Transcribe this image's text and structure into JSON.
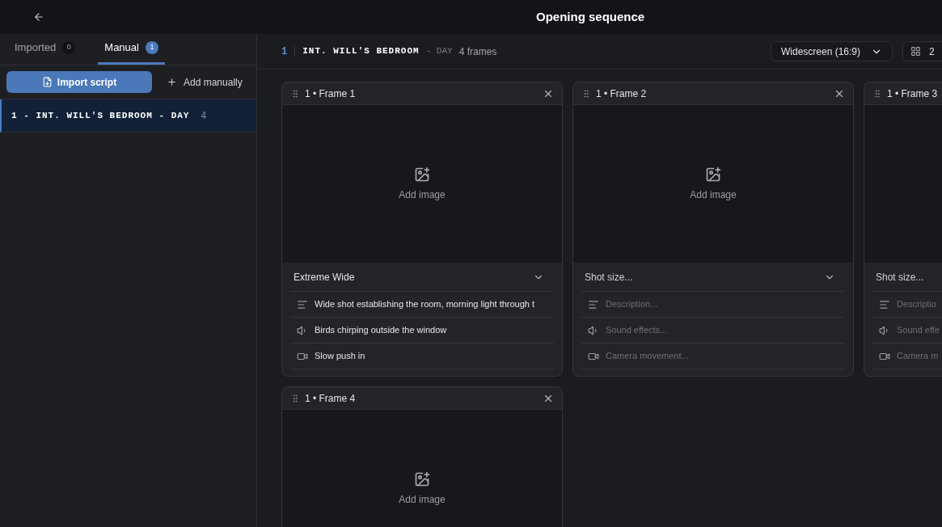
{
  "header": {
    "title": "Opening sequence"
  },
  "sidebar": {
    "tabs": [
      {
        "label": "Imported",
        "count": "0",
        "selected": false
      },
      {
        "label": "Manual",
        "count": "1",
        "selected": true
      }
    ],
    "actions": {
      "import": "Import script",
      "add": "Add manually"
    },
    "scenes": [
      {
        "label": "1 - INT. WILL'S BEDROOM - DAY",
        "count": "4",
        "selected": true
      }
    ]
  },
  "scene_header": {
    "number": "1",
    "heading": "INT. WILL'S BEDROOM",
    "time": "- DAY",
    "frames": "4 frames",
    "aspect": "Widescreen (16:9)",
    "columns": "2"
  },
  "frames": [
    {
      "title": "1 • Frame 1",
      "add_image": "Add image",
      "shot_size": {
        "value": "Extreme Wide"
      },
      "fields": [
        {
          "kind": "description",
          "value": "Wide shot establishing the room, morning light through t"
        },
        {
          "kind": "sound",
          "value": "Birds chirping outside the window"
        },
        {
          "kind": "camera",
          "value": "Slow push in"
        }
      ]
    },
    {
      "title": "1 • Frame 2",
      "add_image": "Add image",
      "shot_size": {
        "placeholder": "Shot size..."
      },
      "fields": [
        {
          "kind": "description",
          "placeholder": "Description..."
        },
        {
          "kind": "sound",
          "placeholder": "Sound effects..."
        },
        {
          "kind": "camera",
          "placeholder": "Camera movement..."
        }
      ]
    },
    {
      "title": "1 • Frame 3",
      "shot_size": {
        "placeholder": "Shot size..."
      },
      "fields": [
        {
          "kind": "description",
          "placeholder": "Descriptio"
        },
        {
          "kind": "sound",
          "placeholder": "Sound effe"
        },
        {
          "kind": "camera",
          "placeholder": "Camera m"
        }
      ]
    },
    {
      "title": "1 • Frame 4",
      "add_image": "Add image"
    }
  ]
}
